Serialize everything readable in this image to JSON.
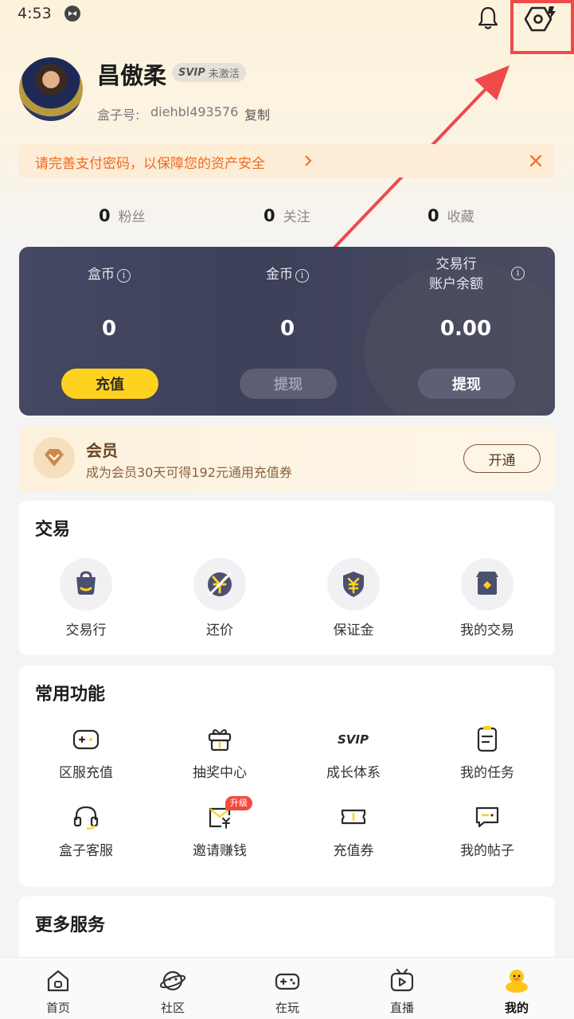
{
  "status_bar": {
    "time": "4:53"
  },
  "profile": {
    "name": "昌傲柔",
    "svip_logo": "SVIP",
    "svip_status": "未激活",
    "box_id_label": "盒子号:",
    "box_id_value": "diehbl493576",
    "copy_label": "复制"
  },
  "notice": {
    "text": "请完善支付密码，以保障您的资产安全"
  },
  "stats": [
    {
      "value": "0",
      "label": "粉丝"
    },
    {
      "value": "0",
      "label": "关注"
    },
    {
      "value": "0",
      "label": "收藏"
    }
  ],
  "wallet": {
    "columns": [
      {
        "label": "盒币",
        "label2": "",
        "value": "0",
        "button": "充值"
      },
      {
        "label": "金币",
        "label2": "",
        "value": "0",
        "button": "提现"
      },
      {
        "label": "交易行",
        "label2": "账户余额",
        "value": "0.00",
        "button": "提现"
      }
    ]
  },
  "member": {
    "title": "会员",
    "desc": "成为会员30天可得192元通用充值券",
    "button": "开通"
  },
  "trade_section": {
    "title": "交易",
    "items": [
      {
        "label": "交易行",
        "icon": "bag-icon"
      },
      {
        "label": "还价",
        "icon": "bargain-icon"
      },
      {
        "label": "保证金",
        "icon": "shield-yuan-icon"
      },
      {
        "label": "我的交易",
        "icon": "store-icon"
      }
    ]
  },
  "common_section": {
    "title": "常用功能",
    "items": [
      {
        "label": "区服充值",
        "icon": "gamepad-icon"
      },
      {
        "label": "抽奖中心",
        "icon": "gift-icon"
      },
      {
        "label": "成长体系",
        "icon": "svip-icon"
      },
      {
        "label": "我的任务",
        "icon": "clipboard-icon"
      },
      {
        "label": "盒子客服",
        "icon": "headset-icon"
      },
      {
        "label": "邀请赚钱",
        "icon": "envelope-yuan-icon",
        "badge": "升级"
      },
      {
        "label": "充值券",
        "icon": "ticket-icon"
      },
      {
        "label": "我的帖子",
        "icon": "message-icon"
      }
    ],
    "svip_text": "SVIP"
  },
  "more_section": {
    "title": "更多服务"
  },
  "tabbar": {
    "tabs": [
      {
        "label": "首页",
        "icon": "home-icon"
      },
      {
        "label": "社区",
        "icon": "planet-icon"
      },
      {
        "label": "在玩",
        "icon": "gamepad-icon"
      },
      {
        "label": "直播",
        "icon": "tv-icon"
      },
      {
        "label": "我的",
        "icon": "duck-icon",
        "active": true
      }
    ]
  },
  "colors": {
    "accent": "#ffd21f",
    "notice_text": "#f06a1e",
    "highlight": "#ee4a4a",
    "wallet_bg": "#434660"
  }
}
